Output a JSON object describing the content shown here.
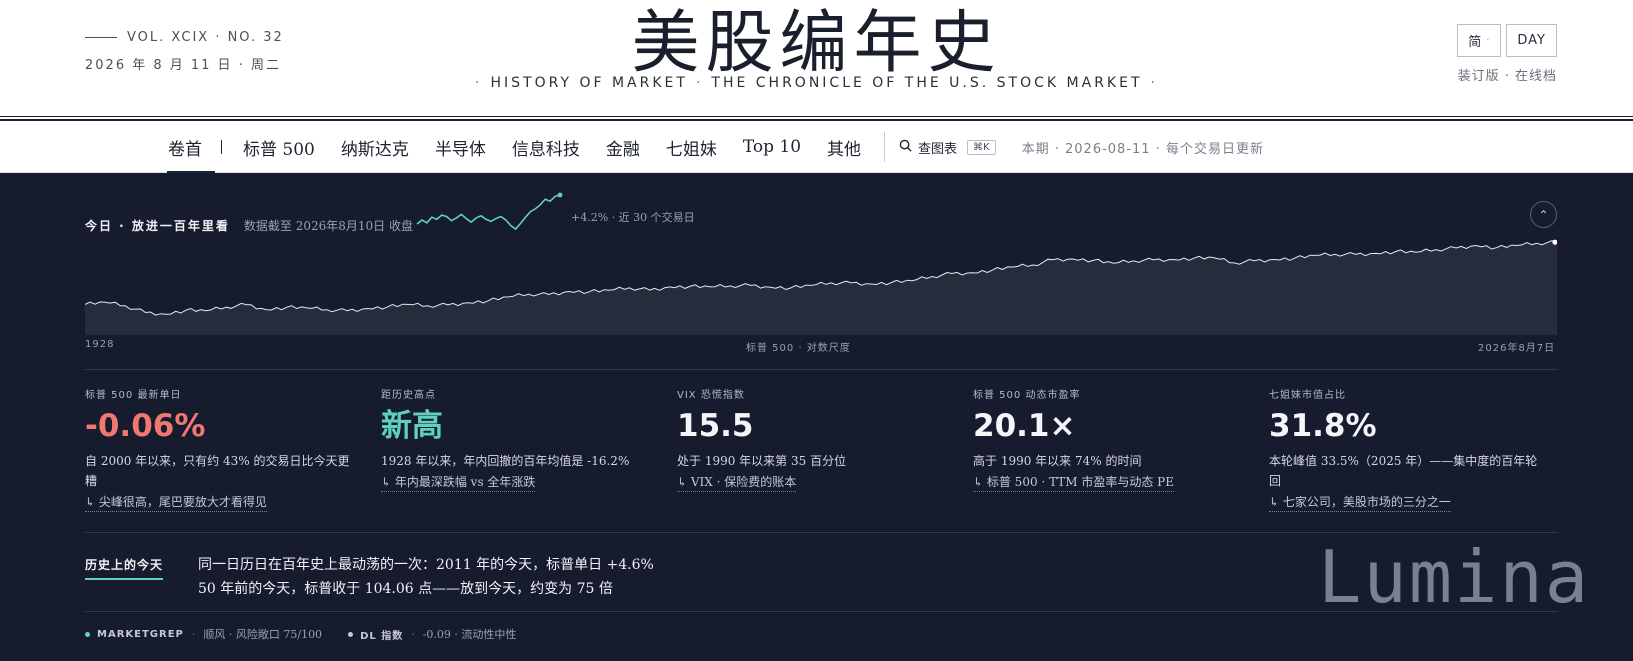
{
  "masthead": {
    "vol": "VOL. XCIX · NO. 32",
    "date": "2026 年 8 月 11 日 · 周二",
    "title": "美股编年史",
    "subtitle_left": "HISTORY OF MARKET",
    "subtitle_right": "THE CHRONICLE OF THE U.S. STOCK MARKET",
    "lang_button": "简",
    "mode_button": "DAY",
    "edition": "装订版 · 在线档"
  },
  "nav": {
    "items": [
      {
        "label": "卷首"
      },
      {
        "label": "标普 500"
      },
      {
        "label": "纳斯达克"
      },
      {
        "label": "半导体"
      },
      {
        "label": "信息科技"
      },
      {
        "label": "金融"
      },
      {
        "label": "七姐妹"
      },
      {
        "label": "Top 10"
      },
      {
        "label": "其他"
      }
    ],
    "search_label": "查图表",
    "search_shortcut": "⌘K",
    "issue": "本期 · 2026-08-11 · 每个交易日更新"
  },
  "today": {
    "label": "今日 · 放进一百年里看",
    "data_note": "数据截至 2026年8月10日 收盘",
    "spark_note": "+4.2% · 近 30 个交易日",
    "axis_start": "1928",
    "axis_mid": "标普 500 · 对数尺度",
    "axis_end": "2026年8月7日"
  },
  "chart_data": {
    "type": "line",
    "title": "",
    "xlabel": "标普 500 · 对数尺度",
    "ylabel": "",
    "x_range": [
      "1928",
      "2026年8月7日"
    ],
    "y_scale": "log",
    "grid": false,
    "series": [
      {
        "values": [
          17.5,
          21.5,
          15.3,
          8.1,
          6.9,
          10.1,
          9.5,
          13.4,
          17.2,
          10.6,
          13.2,
          12.5,
          10.6,
          9.6,
          11.8,
          13.8,
          17.4,
          15.3,
          16.8,
          20.4,
          24.8,
          35.6,
          46.7,
          44.8,
          59.9,
          58.1,
          67.1,
          84.8,
          68.3,
          92.4,
          96.5,
          92.2,
          102,
          107,
          90.2,
          84.3,
          107,
          136,
          135,
          122,
          140,
          167,
          248,
          330,
          353,
          459,
          615,
          740,
          1229,
          1320,
          1148,
          880,
          1112,
          1211,
          1248,
          1418,
          1468,
          903,
          1115,
          1258,
          1426,
          1848,
          2059,
          2044,
          2239,
          2674,
          2507,
          3231,
          3756,
          4766,
          3840,
          4770,
          5882,
          6500
        ]
      }
    ],
    "sparkline": {
      "period": "近 30 个交易日",
      "change_pct": 4.2,
      "values": [
        100,
        100.6,
        100.2,
        101.0,
        100.7,
        101.3,
        101.1,
        100.5,
        100.9,
        101.4,
        100.8,
        100.3,
        100.9,
        101.2,
        100.7,
        100.4,
        100.8,
        101.1,
        100.6,
        99.8,
        99.3,
        100.1,
        101.0,
        101.8,
        102.2,
        102.8,
        103.6,
        103.3,
        104.0,
        104.2
      ]
    }
  },
  "stats": [
    {
      "label": "标普 500 最新单日",
      "value": "-0.06%",
      "desc": "自 2000 年以来，只有约 43% 的交易日比今天更糟",
      "link": "↳ 尖峰很高，尾巴要放大才看得见"
    },
    {
      "label": "距历史高点",
      "value": "新高",
      "desc": "1928 年以来，年内回撤的百年均值是 -16.2%",
      "link": "↳ 年内最深跌幅 vs 全年涨跌"
    },
    {
      "label": "VIX 恐慌指数",
      "value": "15.5",
      "desc": "处于 1990 年以来第 35 百分位",
      "link": "↳ VIX · 保险费的账本"
    },
    {
      "label": "标普 500 动态市盈率",
      "value": "20.1×",
      "desc": "高于 1990 年以来 74% 的时间",
      "link": "↳ 标普 500 · TTM 市盈率与动态 PE"
    },
    {
      "label": "七姐妹市值占比",
      "value": "31.8%",
      "desc": "本轮峰值 33.5%（2025 年）——集中度的百年轮回",
      "link": "↳ 七家公司，美股市场的三分之一"
    }
  ],
  "history": {
    "label": "历史上的今天",
    "line1": "同一日历日在百年史上最动荡的一次：2011 年的今天，标普单日 +4.6%",
    "line2": "50 年前的今天，标普收于 104.06 点——放到今天，约变为 75 倍"
  },
  "watermark": "Lumina",
  "footer": {
    "item1_name": "MARKETGREP",
    "item1_value": "顺风 · 风险敞口 75/100",
    "item2_name": "DL 指数",
    "item2_value": "-0.09 · 流动性中性"
  },
  "colors": {
    "panel_bg": "#161b2e",
    "negative": "#f07870",
    "accent_teal": "#5fd0c0",
    "ink": "#1a1f2e"
  }
}
